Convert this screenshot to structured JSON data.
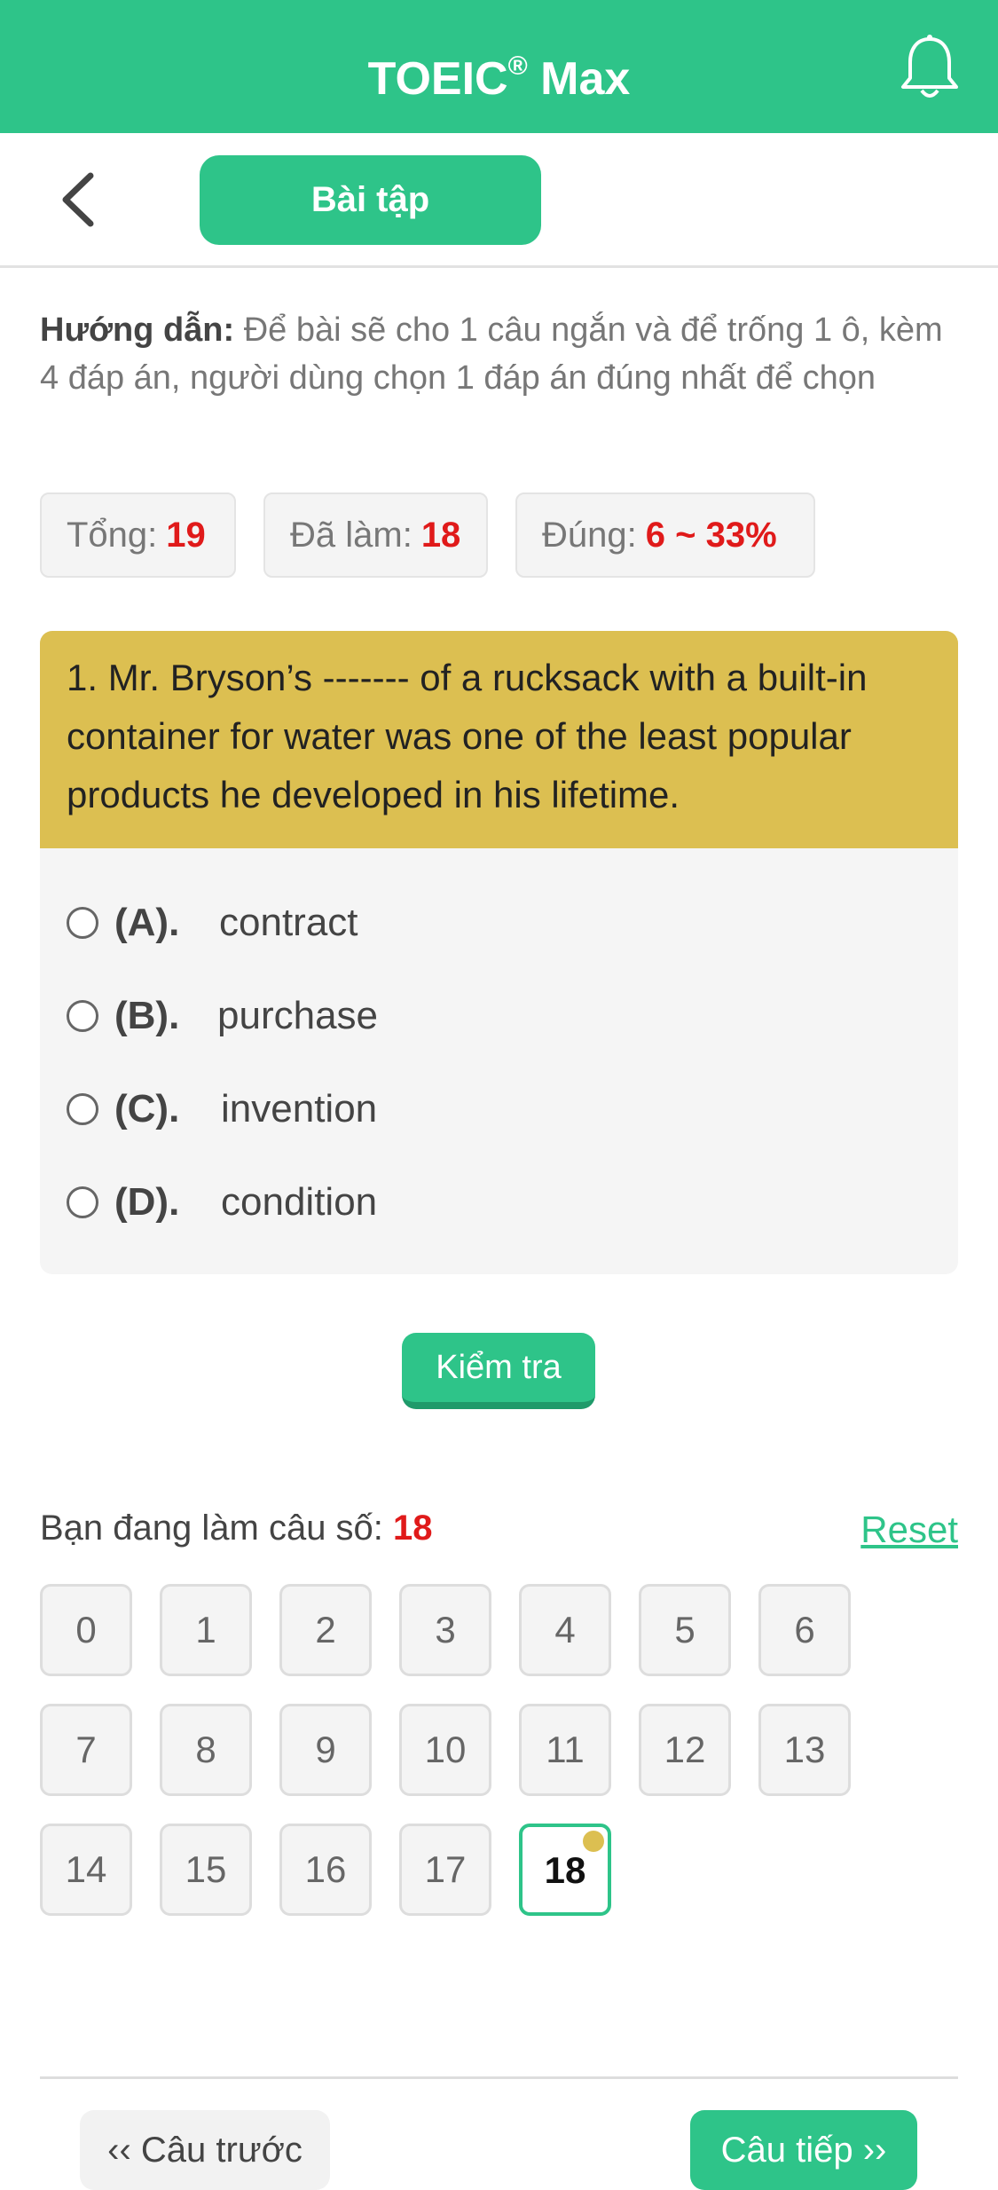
{
  "app": {
    "title": "TOEIC",
    "title_mark": "®",
    "title_suffix": " Max",
    "accent_color": "#2ec489"
  },
  "subbar": {
    "tab_label": "Bài tập"
  },
  "guide": {
    "label": "Hướng dẫn:",
    "text": " Để bài sẽ cho 1 câu ngắn và để trống 1 ô, kèm 4 đáp án, người dùng chọn 1 đáp án đúng nhất để chọn"
  },
  "stats": {
    "total_label": "Tổng:",
    "total_value": "19",
    "done_label": "Đã làm:",
    "done_value": "18",
    "correct_label": "Đúng:",
    "correct_value": "6 ~ 33%"
  },
  "question": {
    "text": "1. Mr. Bryson’s ------- of a rucksack with a built-in container for water was one of the least popular products he developed in his lifetime.",
    "options": [
      {
        "label": "(A).",
        "text": "contract"
      },
      {
        "label": "(B).",
        "text": "purchase"
      },
      {
        "label": "(C).",
        "text": "invention"
      },
      {
        "label": "(D).",
        "text": "condition"
      }
    ]
  },
  "check_button": "Kiểm tra",
  "progress": {
    "label": "Bạn đang làm câu số:",
    "current": "18",
    "reset_label": "Reset"
  },
  "question_numbers": [
    "0",
    "1",
    "2",
    "3",
    "4",
    "5",
    "6",
    "7",
    "8",
    "9",
    "10",
    "11",
    "12",
    "13",
    "14",
    "15",
    "16",
    "17",
    "18"
  ],
  "nav": {
    "prev_label": "‹‹ Câu trước",
    "next_label": "Câu tiếp ››"
  }
}
